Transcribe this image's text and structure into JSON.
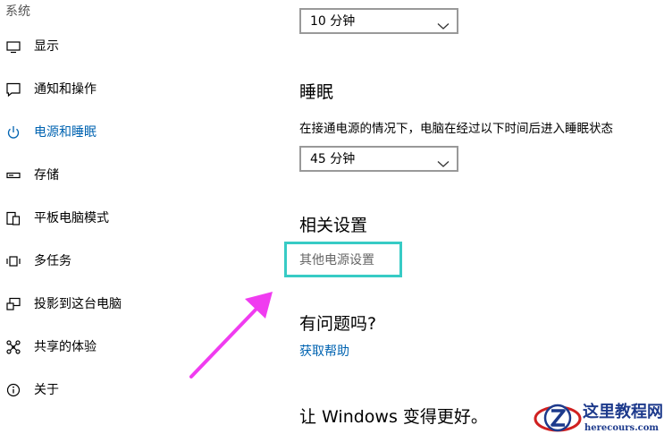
{
  "sidebar": {
    "header": "系统",
    "items": [
      {
        "label": "显示",
        "icon": "display-icon",
        "active": false
      },
      {
        "label": "通知和操作",
        "icon": "notification-icon",
        "active": false
      },
      {
        "label": "电源和睡眠",
        "icon": "power-icon",
        "active": true
      },
      {
        "label": "存储",
        "icon": "storage-icon",
        "active": false
      },
      {
        "label": "平板电脑模式",
        "icon": "tablet-mode-icon",
        "active": false
      },
      {
        "label": "多任务",
        "icon": "multitasking-icon",
        "active": false
      },
      {
        "label": "投影到这台电脑",
        "icon": "project-icon",
        "active": false
      },
      {
        "label": "共享的体验",
        "icon": "shared-experience-icon",
        "active": false
      },
      {
        "label": "关于",
        "icon": "info-icon",
        "active": false
      }
    ],
    "accent_color": "#0063b1"
  },
  "main": {
    "screen_timeout_select": {
      "value": "10 分钟"
    },
    "sleep": {
      "title": "睡眠",
      "description": "在接通电源的情况下，电脑在经过以下时间后进入睡眠状态",
      "select": {
        "value": "45 分钟"
      }
    },
    "related_settings": {
      "title": "相关设置",
      "link": "其他电源设置",
      "highlight_color": "#37cbc5"
    },
    "questions": {
      "title": "有问题吗?",
      "link": "获取帮助"
    },
    "feedback": {
      "title": "让 Windows 变得更好。"
    }
  },
  "annotation": {
    "arrow_color": "#f03cf0"
  },
  "watermark": {
    "title": "这里教程网",
    "url": "herecours.com"
  }
}
